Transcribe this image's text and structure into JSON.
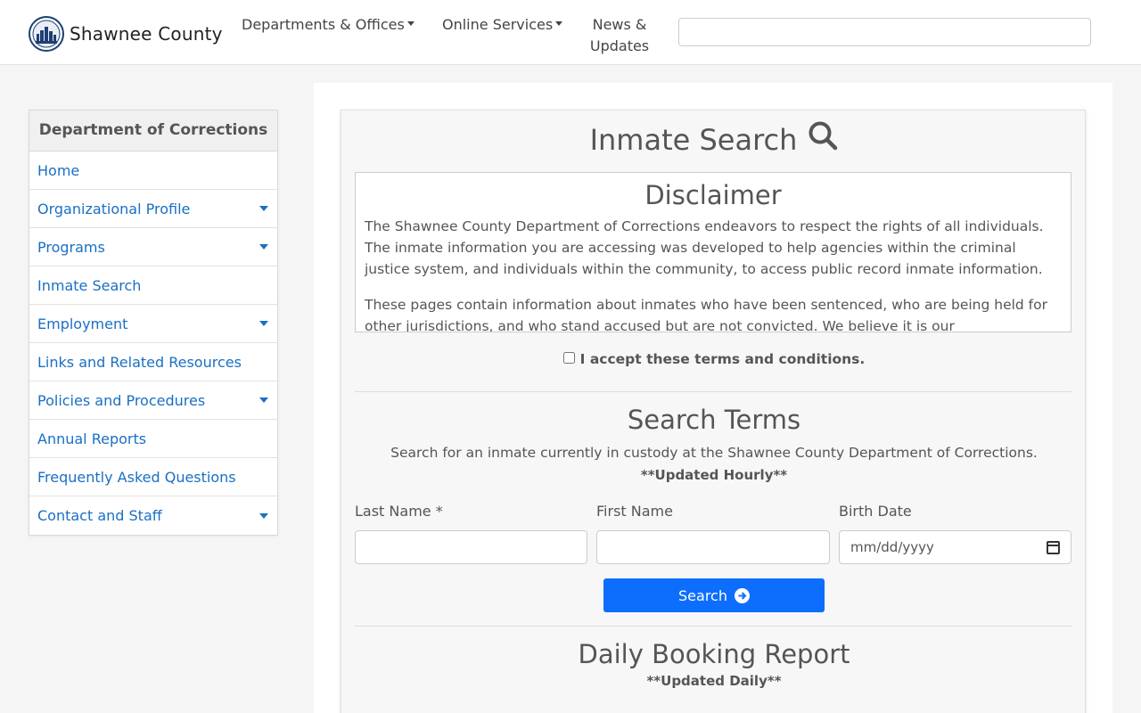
{
  "header": {
    "brand": "Shawnee County",
    "nav": [
      {
        "label": "Departments & Offices"
      },
      {
        "label": "Online Services"
      }
    ],
    "news_line1": "News &",
    "news_line2": "Updates",
    "search_placeholder": ""
  },
  "sidebar": {
    "title": "Department of Corrections",
    "items": [
      {
        "label": "Home",
        "has_submenu": false
      },
      {
        "label": "Organizational Profile",
        "has_submenu": true
      },
      {
        "label": "Programs",
        "has_submenu": true
      },
      {
        "label": "Inmate Search",
        "has_submenu": false
      },
      {
        "label": "Employment",
        "has_submenu": true
      },
      {
        "label": "Links and Related Resources",
        "has_submenu": false
      },
      {
        "label": "Policies and Procedures",
        "has_submenu": true
      },
      {
        "label": "Annual Reports",
        "has_submenu": false
      },
      {
        "label": "Frequently Asked Questions",
        "has_submenu": false
      },
      {
        "label": "Contact and Staff",
        "has_submenu": true
      }
    ]
  },
  "main": {
    "title": "Inmate Search",
    "disclaimer": {
      "title": "Disclaimer",
      "p1": "The Shawnee County Department of Corrections endeavors to respect the rights of all individuals. The inmate information you are accessing was developed to help agencies within the criminal justice system, and individuals within the community, to access public record inmate information.",
      "p2": "These pages contain information about inmates who have been sentenced, who are being held for other jurisdictions, and who stand accused but are not convicted. We believe it is our"
    },
    "accept_label": "I accept these terms and conditions.",
    "search_terms": {
      "title": "Search Terms",
      "subtitle": "Search for an inmate currently in custody at the Shawnee County Department of Corrections.",
      "updated": "**Updated Hourly**",
      "last_name_label": "Last Name *",
      "first_name_label": "First Name",
      "birth_date_label": "Birth Date",
      "last_name_value": "",
      "first_name_value": "",
      "birth_date_placeholder": "mm/dd/yyyy",
      "button_label": "Search"
    },
    "booking": {
      "title": "Daily Booking Report",
      "updated": "**Updated Daily**"
    }
  },
  "colors": {
    "link": "#1a6fc4",
    "primary_button": "#0d6efd"
  }
}
